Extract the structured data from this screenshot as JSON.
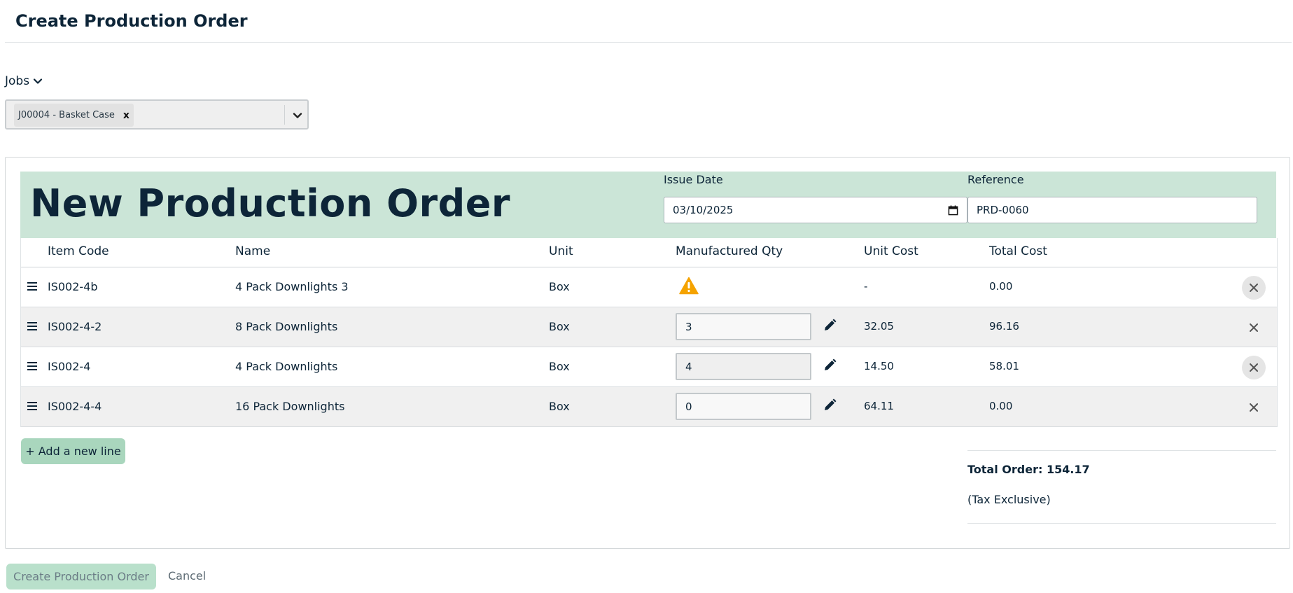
{
  "page": {
    "title": "Create Production Order"
  },
  "jobs": {
    "label": "Jobs",
    "selected_chip": "J00004 - Basket Case",
    "chip_remove": "x"
  },
  "order": {
    "heading": "New Production Order",
    "issue_date": {
      "label": "Issue Date",
      "value": "03/10/2025"
    },
    "reference": {
      "label": "Reference",
      "value": "PRD-0060"
    }
  },
  "table": {
    "columns": {
      "item_code": "Item Code",
      "name": "Name",
      "unit": "Unit",
      "qty": "Manufactured Qty",
      "unit_cost": "Unit Cost",
      "total_cost": "Total Cost"
    },
    "rows": [
      {
        "item_code": "IS002-4b",
        "name": "4 Pack Downlights 3",
        "unit": "Box",
        "qty": "",
        "qty_warning": true,
        "unit_cost": "-",
        "total_cost": "0.00"
      },
      {
        "item_code": "IS002-4-2",
        "name": "8 Pack Downlights",
        "unit": "Box",
        "qty": "3",
        "qty_warning": false,
        "unit_cost": "32.05",
        "total_cost": "96.16"
      },
      {
        "item_code": "IS002-4",
        "name": "4 Pack Downlights",
        "unit": "Box",
        "qty": "4",
        "qty_warning": false,
        "unit_cost": "14.50",
        "total_cost": "58.01"
      },
      {
        "item_code": "IS002-4-4",
        "name": "16 Pack Downlights",
        "unit": "Box",
        "qty": "0",
        "qty_warning": false,
        "unit_cost": "64.11",
        "total_cost": "0.00"
      }
    ]
  },
  "actions": {
    "add_line": "+ Add a new line",
    "total_order": "Total Order: 154.17",
    "tax_note": "(Tax Exclusive)",
    "create": "Create Production Order",
    "cancel": "Cancel"
  },
  "icons": {
    "drag": "drag-handle-icon",
    "pencil": "pencil-icon",
    "warning": "warning-icon",
    "remove": "close-icon",
    "chevron": "chevron-down-icon",
    "calendar": "calendar-icon"
  },
  "colors": {
    "header_band": "#cbe5d7",
    "primary_button": "#a9d6bd",
    "warning": "#f5a300",
    "text": "#0d2538"
  }
}
